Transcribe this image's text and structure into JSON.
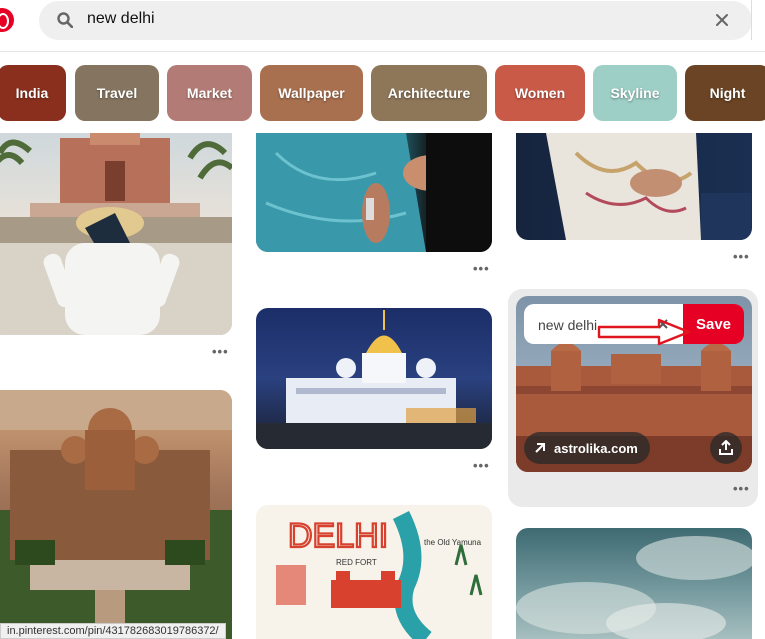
{
  "search": {
    "query": "new delhi"
  },
  "chips": [
    {
      "label": "India",
      "color": "#8a2f1e"
    },
    {
      "label": "Travel",
      "color": "#857560"
    },
    {
      "label": "Market",
      "color": "#b37b75"
    },
    {
      "label": "Wallpaper",
      "color": "#a8704e"
    },
    {
      "label": "Architecture",
      "color": "#8e7659"
    },
    {
      "label": "Women",
      "color": "#c95a48"
    },
    {
      "label": "Skyline",
      "color": "#9dcfc6"
    },
    {
      "label": "Night",
      "color": "#6a4424"
    }
  ],
  "save_overlay": {
    "board_select": "new delhi",
    "save_label": "Save",
    "source_link": "astrolika.com"
  },
  "status_bar": {
    "url": "in.pinterest.com/pin/431782683019786372/"
  },
  "colors": {
    "accent": "#e60023"
  }
}
